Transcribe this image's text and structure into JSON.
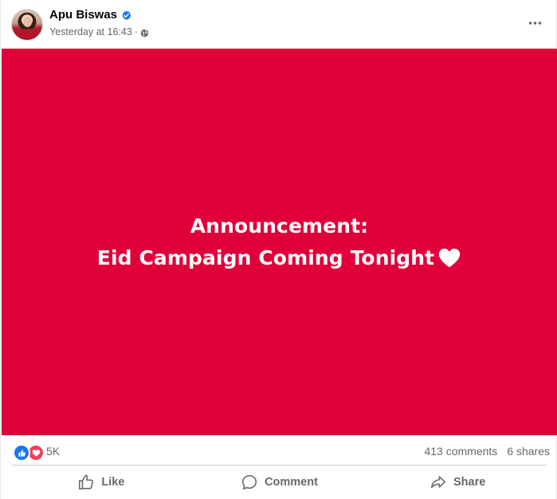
{
  "post": {
    "author_name": "Apu Biswas",
    "timestamp": "Yesterday at 16:43",
    "separator": "·",
    "privacy_icon": "globe-icon",
    "verified_icon": "verified-badge-icon",
    "more_icon": "more-dots-icon",
    "media": {
      "background_color": "#e0003a",
      "line1": "Announcement:",
      "line2": "Eid Campaign Coming Tonight",
      "emoji": "white-heart-icon"
    }
  },
  "reactions": {
    "icons": [
      "like-icon",
      "love-icon"
    ],
    "count": "5K",
    "comments": "413 comments",
    "shares": "6 shares"
  },
  "actions": {
    "like_label": "Like",
    "comment_label": "Comment",
    "share_label": "Share"
  },
  "colors": {
    "like_blue": "#1877f2",
    "love_red": "#f33e58",
    "secondary_text": "#65676b"
  }
}
